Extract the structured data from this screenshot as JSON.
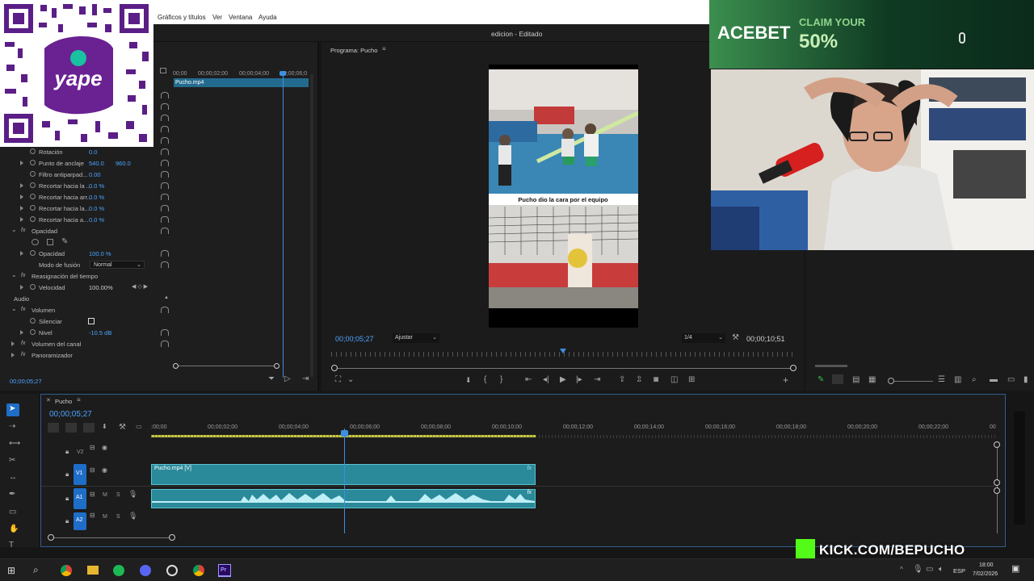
{
  "menu": {
    "items": [
      "Gráficos y títulos",
      "Ver",
      "Ventana",
      "Ayuda"
    ]
  },
  "window": {
    "title": "edicion - Editado"
  },
  "effect_controls": {
    "clip_name": "Pucho.mp4",
    "ruler_ticks": [
      "00;00",
      "00;00;02;00",
      "00;00;04;00",
      "00;00;06;0"
    ],
    "rows": [
      {
        "label": "Rotación",
        "value": "0.0"
      },
      {
        "label": "Punto de anclaje",
        "value": "540.0",
        "value2": "960.0"
      },
      {
        "label": "Filtro antiparpad...",
        "value": "0.00"
      },
      {
        "label": "Recortar hacia la ...",
        "value": "0.0 %"
      },
      {
        "label": "Recortar hacia arr...",
        "value": "0.0 %"
      },
      {
        "label": "Recortar hacia la...",
        "value": "0.0 %"
      },
      {
        "label": "Recortar hacia a...",
        "value": "0.0 %"
      }
    ],
    "opacity_header": "Opacidad",
    "opacity_label": "Opacidad",
    "opacity_value": "100.0 %",
    "blend_label": "Modo de fusión",
    "blend_value": "Normal",
    "time_remap": "Reasignación del tiempo",
    "speed_label": "Velocidad",
    "speed_value": "100.00%",
    "audio_header": "Audio",
    "volume_header": "Volumen",
    "mute_label": "Silenciar",
    "level_label": "Nivel",
    "level_value": "-10.5 dB",
    "channel_volume": "Volumen del canal",
    "panner": "Panoramizador",
    "timecode": "00;00;05;27"
  },
  "program": {
    "label": "Programa: Pucho",
    "timecode": "00;00;05;27",
    "fit": "Ajustar",
    "resolution": "1/4",
    "duration": "00;00;10;51",
    "caption": "Pucho dio la cara por el equipo",
    "playhead_fraction": 0.5
  },
  "ad": {
    "brand": "ACEBET",
    "promo": "CLAIM YOUR",
    "percent": "50%"
  },
  "timeline": {
    "sequence": "Pucho",
    "timecode": "00;00;05;27",
    "ruler": [
      ":00;00",
      "00;00;02;00",
      "00;00;04;00",
      "00;00;06;00",
      "00;00;08;00",
      "00;00;10;00",
      "00;00;12;00",
      "00;00;14;00",
      "00;00;16;00",
      "00;00;18;00",
      "00;00;20;00",
      "00;00;22;00",
      "00"
    ],
    "tracks": {
      "v2": "V2",
      "v1": "V1",
      "a1": "A1",
      "a2": "A2",
      "m": "M",
      "s": "S"
    },
    "video_clip": "Pucho.mp4 [V]",
    "fx_badge": "fx"
  },
  "watermark": {
    "text": "KICK.COM/BEPUCHO"
  },
  "taskbar": {
    "lang": "ESP",
    "time": "18:00",
    "date": "7/02/2026"
  },
  "colors": {
    "accent_blue": "#1e6ec8",
    "clip_teal": "#2a8a9a",
    "timecode_blue": "#4da3ff",
    "kick_green": "#53fc18"
  }
}
